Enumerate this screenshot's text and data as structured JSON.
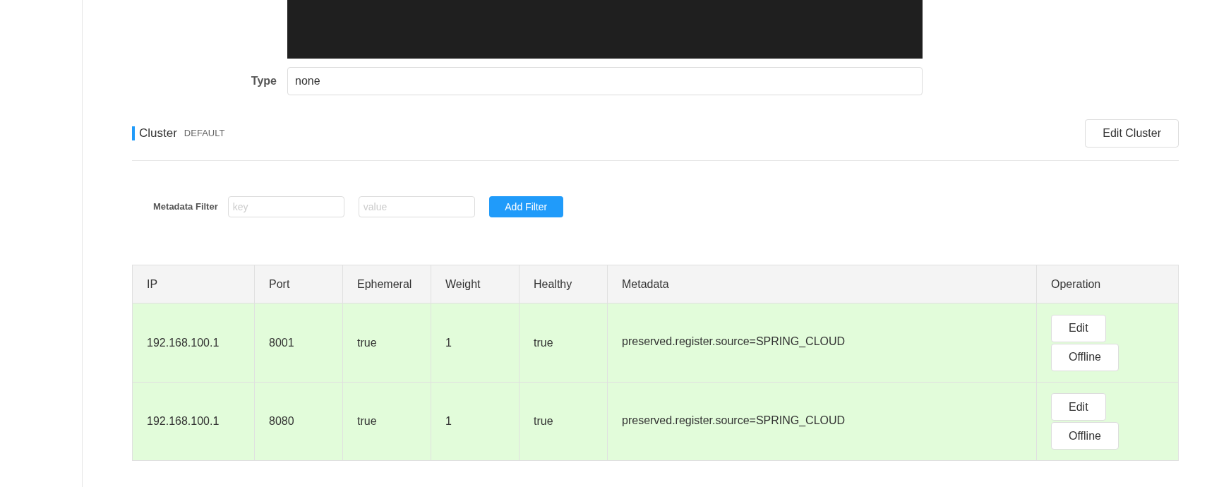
{
  "type_field": {
    "label": "Type",
    "value": "none"
  },
  "cluster": {
    "title": "Cluster",
    "name": "DEFAULT",
    "edit_button": "Edit Cluster"
  },
  "filter": {
    "label": "Metadata Filter",
    "key_placeholder": "key",
    "value_placeholder": "value",
    "button": "Add Filter"
  },
  "table": {
    "columns": [
      "IP",
      "Port",
      "Ephemeral",
      "Weight",
      "Healthy",
      "Metadata",
      "Operation"
    ],
    "rows": [
      {
        "ip": "192.168.100.1",
        "port": "8001",
        "ephemeral": "true",
        "weight": "1",
        "healthy": "true",
        "metadata": "preserved.register.source=SPRING_CLOUD",
        "actions": [
          "Edit",
          "Offline"
        ]
      },
      {
        "ip": "192.168.100.1",
        "port": "8080",
        "ephemeral": "true",
        "weight": "1",
        "healthy": "true",
        "metadata": "preserved.register.source=SPRING_CLOUD",
        "actions": [
          "Edit",
          "Offline"
        ]
      }
    ]
  }
}
